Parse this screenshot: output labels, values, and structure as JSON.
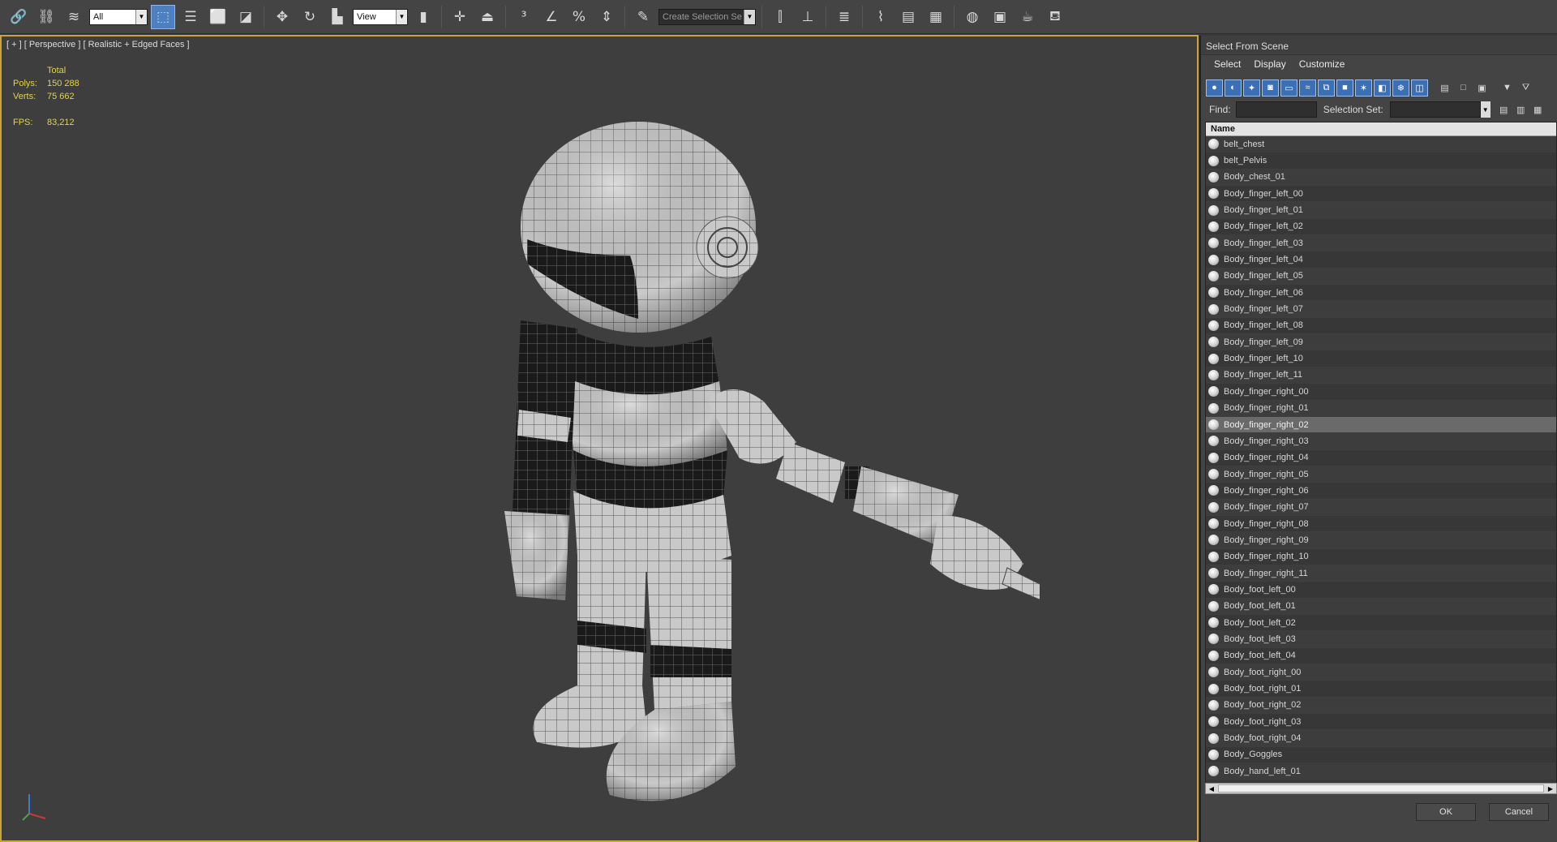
{
  "toolbar": {
    "filter_combo": "All",
    "refcoord_combo": "View",
    "selection_set_placeholder": "Create Selection Se",
    "icons": [
      "link-icon",
      "unlink-icon",
      "bind-spacewarp-icon",
      "select-object-icon",
      "select-by-name-icon",
      "rect-selection-icon",
      "window-crossing-icon",
      "move-icon",
      "rotate-icon",
      "scale-icon",
      "pivot-icon",
      "manipulate-icon",
      "keyboard-shortcut-icon",
      "snap-3d-icon",
      "angle-snap-icon",
      "percent-snap-icon",
      "spinner-snap-icon",
      "edit-named-sets-icon",
      "mirror-icon",
      "align-icon",
      "layer-manager-icon",
      "curve-editor-icon",
      "schematic-view-icon",
      "material-editor-icon",
      "render-setup-icon",
      "rendered-frame-icon",
      "render-icon",
      "teapot-icon"
    ]
  },
  "viewport": {
    "label": "[ + ] [ Perspective ] [ Realistic + Edged Faces ]",
    "stats": {
      "header": "Total",
      "polys_label": "Polys:",
      "polys_value": "150 288",
      "verts_label": "Verts:",
      "verts_value": "75 662",
      "fps_label": "FPS:",
      "fps_value": "83,212"
    },
    "accent_color": "#c7a43d"
  },
  "dialog": {
    "title": "Select From Scene",
    "menu": [
      "Select",
      "Display",
      "Customize"
    ],
    "find_label": "Find:",
    "selection_set_label": "Selection Set:",
    "column_name": "Name",
    "items": [
      "belt_chest",
      "belt_Pelvis",
      "Body_chest_01",
      "Body_finger_left_00",
      "Body_finger_left_01",
      "Body_finger_left_02",
      "Body_finger_left_03",
      "Body_finger_left_04",
      "Body_finger_left_05",
      "Body_finger_left_06",
      "Body_finger_left_07",
      "Body_finger_left_08",
      "Body_finger_left_09",
      "Body_finger_left_10",
      "Body_finger_left_11",
      "Body_finger_right_00",
      "Body_finger_right_01",
      "Body_finger_right_02",
      "Body_finger_right_03",
      "Body_finger_right_04",
      "Body_finger_right_05",
      "Body_finger_right_06",
      "Body_finger_right_07",
      "Body_finger_right_08",
      "Body_finger_right_09",
      "Body_finger_right_10",
      "Body_finger_right_11",
      "Body_foot_left_00",
      "Body_foot_left_01",
      "Body_foot_left_02",
      "Body_foot_left_03",
      "Body_foot_left_04",
      "Body_foot_right_00",
      "Body_foot_right_01",
      "Body_foot_right_02",
      "Body_foot_right_03",
      "Body_foot_right_04",
      "Body_Goggles",
      "Body_hand_left_01"
    ],
    "selected_item": "Body_finger_right_02",
    "ok_label": "OK",
    "cancel_label": "Cancel",
    "selection_color": "#6a6a6a"
  }
}
